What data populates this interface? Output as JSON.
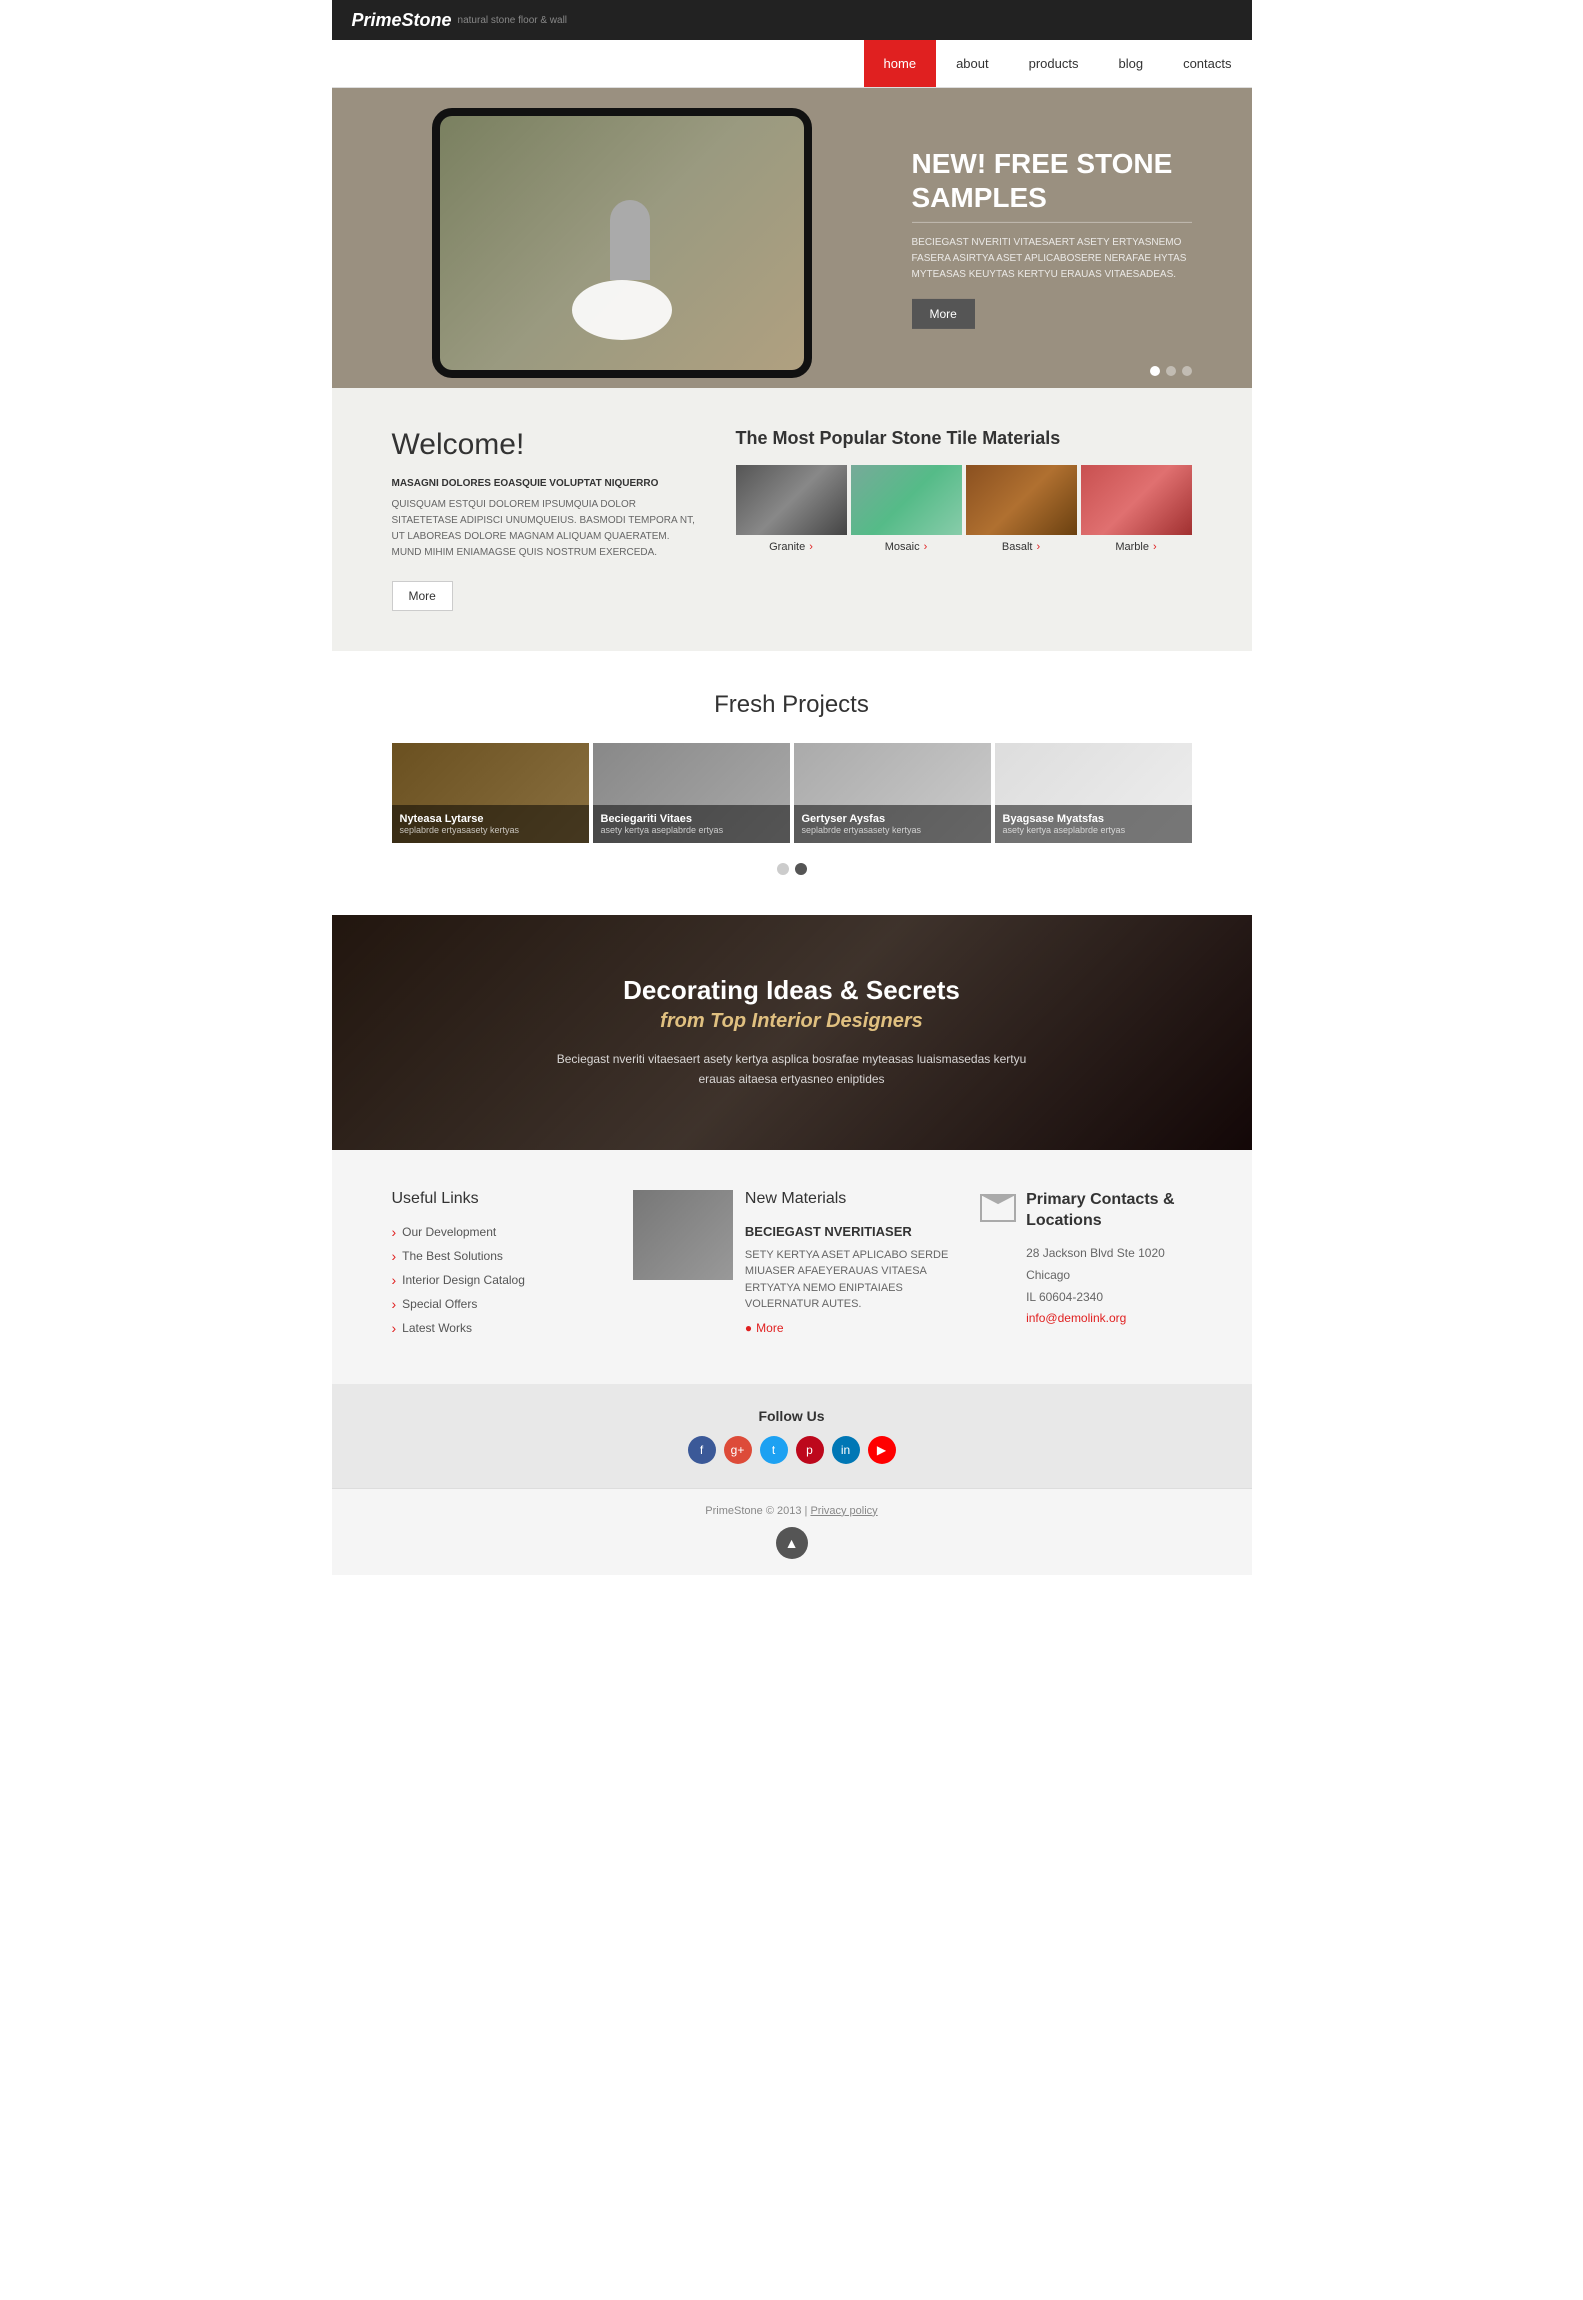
{
  "brand": {
    "name": "PrimeStone",
    "tagline": "natural stone floor & wall"
  },
  "nav": {
    "items": [
      {
        "label": "home",
        "active": true
      },
      {
        "label": "about",
        "active": false
      },
      {
        "label": "products",
        "active": false
      },
      {
        "label": "blog",
        "active": false
      },
      {
        "label": "contacts",
        "active": false
      }
    ]
  },
  "hero": {
    "title": "NEW! FREE STONE SAMPLES",
    "desc": "BECIEGAST NVERITI VITAESAERT ASETY ERTYASNEMO FASERA ASIRTYA ASET APLICABOSERE NERAFAE HYTAS MYTEASAS KEUYTAS KERTYU ERAUAS VITAESADEAS.",
    "btn": "More",
    "dots": [
      true,
      false,
      false
    ]
  },
  "welcome": {
    "title": "Welcome!",
    "subtitle": "MASAGNI DOLORES EOASQUIE VOLUPTAT NIQUERRO",
    "text": "QUISQUAM ESTQUI DOLOREM IPSUMQUIA DOLOR SITAETETASE ADIPISCI UNUMQUEIUS. BASMODI TEMPORA NT, UT LABOREAS DOLORE MAGNAM ALIQUAM QUAERATEМ. MUND MIHIM ENIAMAGSE QUIS NOSTRUM EXERCEDA.",
    "btn": "More",
    "popular_title": "The Most Popular Stone Tile Materials",
    "stones": [
      {
        "name": "Granite",
        "type": "granite"
      },
      {
        "name": "Mosaic",
        "type": "mosaic"
      },
      {
        "name": "Basalt",
        "type": "basalt"
      },
      {
        "name": "Marble",
        "type": "marble"
      }
    ]
  },
  "projects": {
    "title": "Fresh Projects",
    "items": [
      {
        "name": "Nyteasa Lytarse",
        "desc": "seplabrde ertyasasety kertyas"
      },
      {
        "name": "Beciegariti Vitaes",
        "desc": "asety kertya aseplabrde ertyas"
      },
      {
        "name": "Gertyser Aysfas",
        "desc": "seplabrde ertyasasety kertyas"
      },
      {
        "name": "Byagsase Myatsfas",
        "desc": "asety kertya aseplabrde ertyas"
      }
    ]
  },
  "deco": {
    "title": "Decorating Ideas & Secrets",
    "subtitle": "from Top Interior Designers",
    "text": "Beciegast nveriti vitaesaert asety kertya asplica bosrafae myteasas luaismasedas kertyu erauas aitaesa ertyasneo eniptides"
  },
  "footer": {
    "useful_links_title": "Useful Links",
    "links": [
      "Our Development",
      "The Best Solutions",
      "Interior Design Catalog",
      "Special Offers",
      "Latest Works"
    ],
    "news_title": "New Materials",
    "news_subtitle": "BECIEGAST NVERITIASER",
    "news_text": "SETY KERTYA ASET APLICABO SERDE MIUASER AFAEYERAUAS VITAESA ERTYATYA NEMO ENIPTAIAES VOLERNATUR AUTES.",
    "news_more": "More",
    "contact_title": "Primary Contacts & Locations",
    "address_line1": "28 Jackson Blvd Ste 1020",
    "address_line2": "Chicago",
    "address_line3": "IL 60604-2340",
    "email": "info@demolink.org",
    "follow_title": "Follow Us",
    "social": [
      {
        "name": "facebook",
        "class": "si-fb",
        "symbol": "f"
      },
      {
        "name": "google-plus",
        "class": "si-gp",
        "symbol": "g+"
      },
      {
        "name": "twitter",
        "class": "si-tw",
        "symbol": "t"
      },
      {
        "name": "pinterest",
        "class": "si-pi",
        "symbol": "p"
      },
      {
        "name": "linkedin",
        "class": "si-li",
        "symbol": "in"
      },
      {
        "name": "youtube",
        "class": "si-yt",
        "symbol": "▶"
      }
    ],
    "copyright": "PrimeStone © 2013 |",
    "privacy": "Privacy policy"
  }
}
